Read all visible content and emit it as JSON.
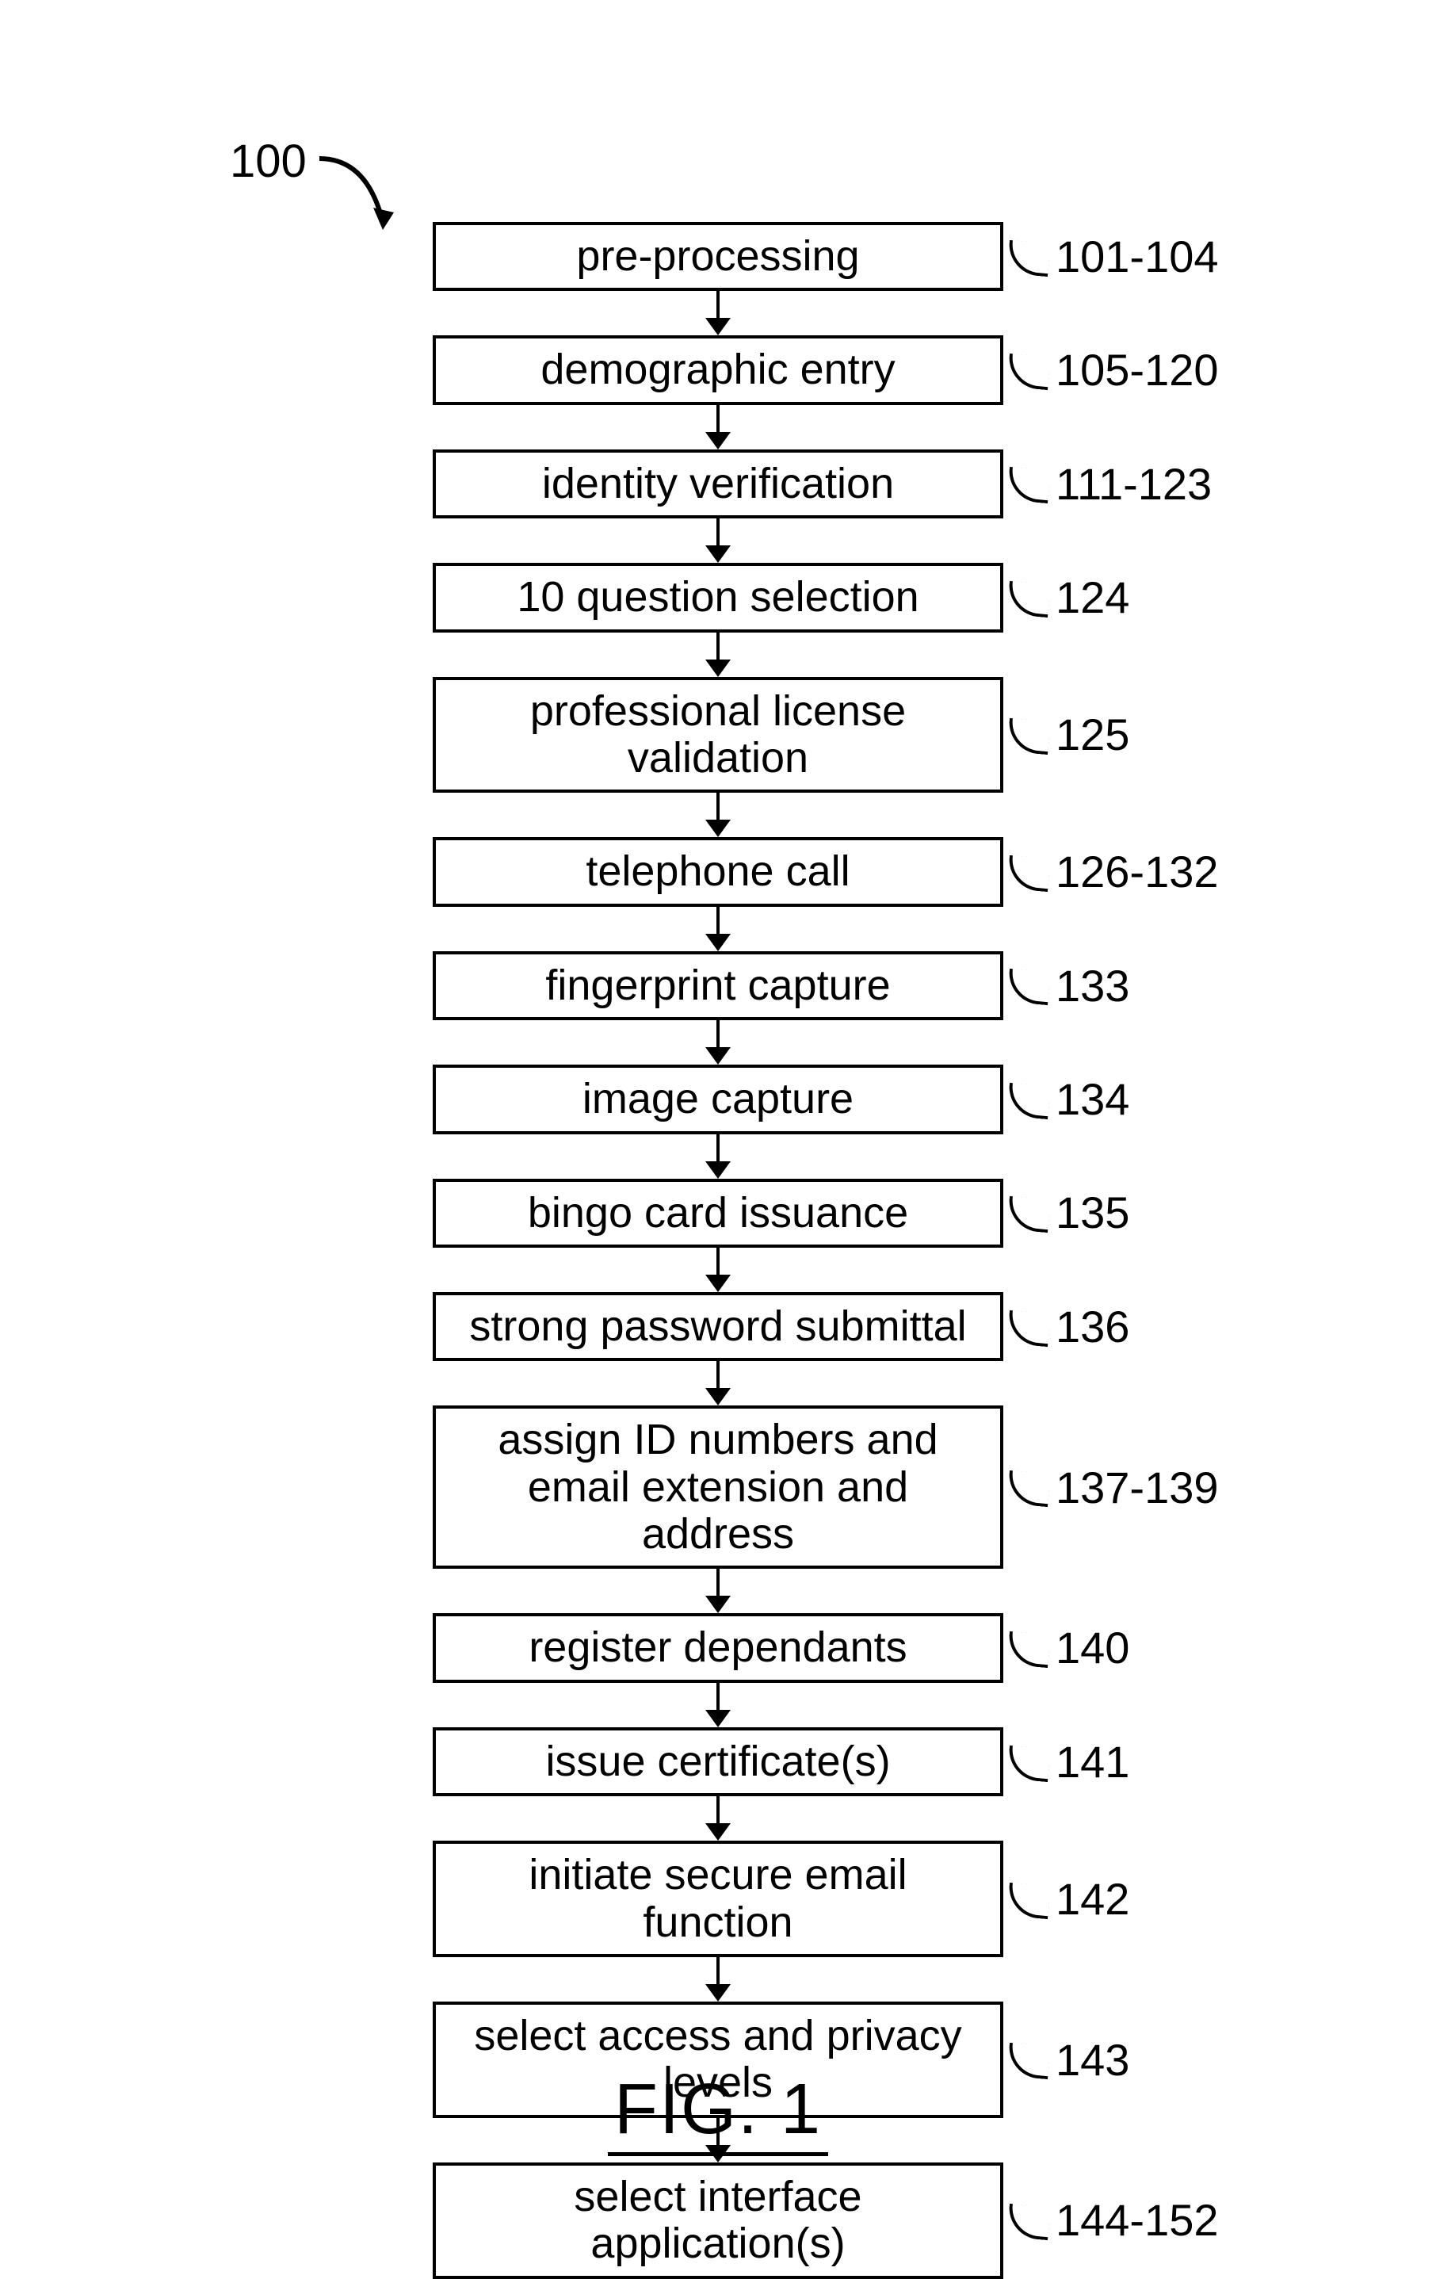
{
  "figure_label": "FIG. 1",
  "diagram_ref": "100",
  "steps": [
    {
      "label": "pre-processing",
      "ref": "101-104"
    },
    {
      "label": "demographic entry",
      "ref": "105-120"
    },
    {
      "label": "identity verification",
      "ref": "111-123"
    },
    {
      "label": "10 question selection",
      "ref": "124"
    },
    {
      "label": "professional license validation",
      "ref": "125"
    },
    {
      "label": "telephone call",
      "ref": "126-132"
    },
    {
      "label": "fingerprint capture",
      "ref": "133"
    },
    {
      "label": "image capture",
      "ref": "134"
    },
    {
      "label": "bingo card issuance",
      "ref": "135"
    },
    {
      "label": "strong password submittal",
      "ref": "136"
    },
    {
      "label": "assign ID numbers and email extension and address",
      "ref": "137-139"
    },
    {
      "label": "register dependants",
      "ref": "140"
    },
    {
      "label": "issue certificate(s)",
      "ref": "141"
    },
    {
      "label": "initiate secure email function",
      "ref": "142"
    },
    {
      "label": "select access and privacy levels",
      "ref": "143"
    },
    {
      "label": "select interface application(s)",
      "ref": "144-152"
    }
  ]
}
